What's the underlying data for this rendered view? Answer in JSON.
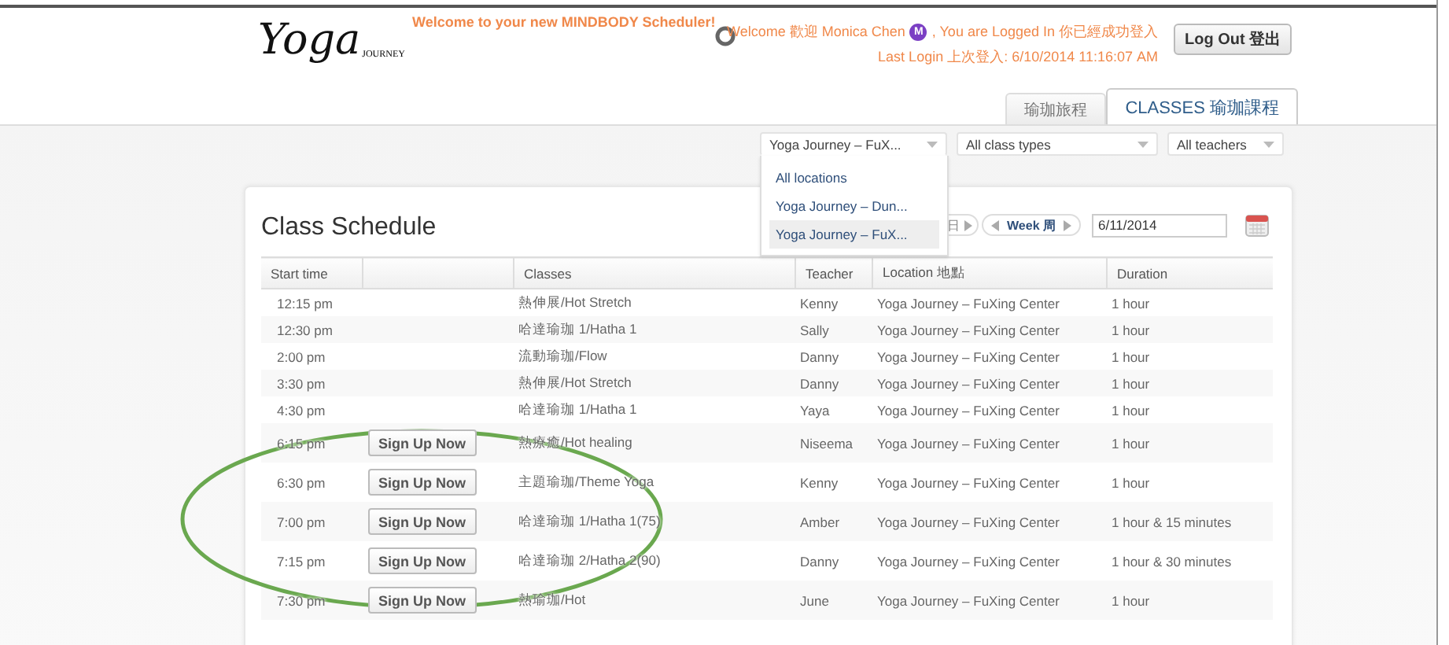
{
  "logo": {
    "title": "Yoga",
    "subtitle": "JOURNEY"
  },
  "header": {
    "banner": "Welcome to your new MINDBODY Scheduler!",
    "welcome": "Welcome 歡迎 Monica Chen",
    "avatar_initial": "M",
    "logged_in": ", You are Logged In 你已經成功登入",
    "last_login": "Last Login 上次登入: 6/10/2014 11:16:07 AM",
    "logout_button": "Log Out 登出"
  },
  "tabs": [
    {
      "label": "瑜珈旅程",
      "selected": false
    },
    {
      "label": "CLASSES 瑜珈課程",
      "selected": true
    }
  ],
  "filters": [
    {
      "value": "Yoga Journey – FuX...",
      "expanded": true
    },
    {
      "value": "All class types",
      "expanded": false
    },
    {
      "value": "All teachers",
      "expanded": false
    }
  ],
  "location_menu": [
    {
      "label": "All locations",
      "selected": false
    },
    {
      "label": "Yoga Journey – Dun...",
      "selected": false
    },
    {
      "label": "Yoga Journey – FuX...",
      "selected": true
    }
  ],
  "schedule": {
    "title": "Class Schedule",
    "day_button": "日",
    "week_button": "Week 周",
    "date": "6/11/2014",
    "columns": [
      "Start time",
      "Classes",
      "Teacher",
      "Location 地點",
      "Duration"
    ],
    "rows": [
      {
        "time": "12:15 pm",
        "class": "熱伸展/Hot Stretch",
        "teacher": "Kenny",
        "location": "Yoga Journey – FuXing Center",
        "duration": "1 hour"
      },
      {
        "time": "12:30 pm",
        "class": "哈達瑜珈 1/Hatha 1",
        "teacher": "Sally",
        "location": "Yoga Journey – FuXing Center",
        "duration": "1 hour"
      },
      {
        "time": "2:00 pm",
        "class": "流動瑜珈/Flow",
        "teacher": "Danny",
        "location": "Yoga Journey – FuXing Center",
        "duration": "1 hour"
      },
      {
        "time": "3:30 pm",
        "class": "熱伸展/Hot Stretch",
        "teacher": "Danny",
        "location": "Yoga Journey – FuXing Center",
        "duration": "1 hour"
      },
      {
        "time": "4:30 pm",
        "class": "哈達瑜珈 1/Hatha 1",
        "teacher": "Yaya",
        "location": "Yoga Journey – FuXing Center",
        "duration": "1 hour"
      },
      {
        "time": "6:15 pm",
        "signup": "Sign Up Now",
        "class": "熱療癒/Hot healing",
        "teacher": "Niseema",
        "location": "Yoga Journey – FuXing Center",
        "duration": "1 hour"
      },
      {
        "time": "6:30 pm",
        "signup": "Sign Up Now",
        "class": "主題瑜珈/Theme Yoga",
        "teacher": "Kenny",
        "location": "Yoga Journey – FuXing Center",
        "duration": "1 hour"
      },
      {
        "time": "7:00 pm",
        "signup": "Sign Up Now",
        "class": "哈達瑜珈 1/Hatha 1(75)",
        "teacher": "Amber",
        "location": "Yoga Journey – FuXing Center",
        "duration": "1 hour & 15 minutes"
      },
      {
        "time": "7:15 pm",
        "signup": "Sign Up Now",
        "class": "哈達瑜珈 2/Hatha 2(90)",
        "teacher": "Danny",
        "location": "Yoga Journey – FuXing Center",
        "duration": "1 hour & 30 minutes"
      },
      {
        "time": "7:30 pm",
        "signup": "Sign Up Now",
        "class": "熱瑜珈/Hot",
        "teacher": "June",
        "location": "Yoga Journey – FuXing Center",
        "duration": "1 hour"
      }
    ]
  }
}
